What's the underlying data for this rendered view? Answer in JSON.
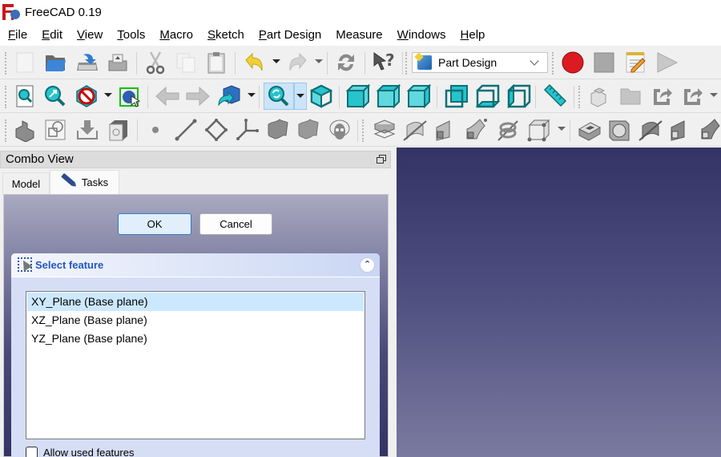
{
  "window": {
    "title": "FreeCAD 0.19",
    "logo_icon": "freecad-logo-icon"
  },
  "menubar": {
    "items": [
      {
        "label": "File",
        "mnemonic": "F",
        "rest": "ile"
      },
      {
        "label": "Edit",
        "mnemonic": "E",
        "rest": "dit"
      },
      {
        "label": "View",
        "mnemonic": "V",
        "rest": "iew"
      },
      {
        "label": "Tools",
        "mnemonic": "T",
        "rest": "ools"
      },
      {
        "label": "Macro",
        "mnemonic": "M",
        "rest": "acro"
      },
      {
        "label": "Sketch",
        "mnemonic": "S",
        "rest": "ketch"
      },
      {
        "label": "Part Design",
        "mnemonic": "P",
        "rest": "art Design"
      },
      {
        "label": "Measure",
        "mnemonic": "",
        "rest": "Measure"
      },
      {
        "label": "Windows",
        "mnemonic": "W",
        "rest": "indows"
      },
      {
        "label": "Help",
        "mnemonic": "H",
        "rest": "elp"
      }
    ]
  },
  "toolbars": {
    "file": [
      "new-document-icon",
      "open-folder-icon",
      "save-icon",
      "print-icon"
    ],
    "edit": [
      "cut-icon",
      "copy-icon",
      "paste-icon",
      "undo-icon",
      "redo-icon",
      "refresh-icon",
      "whats-this-icon"
    ],
    "workbench_selector": {
      "value": "Part Design",
      "icon": "part-design-icon"
    },
    "macro": [
      "macro-record-icon",
      "macro-stop-icon",
      "macro-edit-icon",
      "macro-execute-icon"
    ],
    "view": [
      "fit-all-icon",
      "fit-selection-icon",
      "draw-style-icon",
      "bounding-box-icon",
      "back-arrow-icon",
      "forward-arrow-icon",
      "send-to-python-icon",
      "sync-view-icon",
      "isometric-view-icon",
      "front-view-icon",
      "top-view-icon",
      "right-view-icon",
      "rear-view-icon",
      "bottom-view-icon",
      "left-view-icon",
      "measure-distance-icon"
    ],
    "structure": [
      "part-icon",
      "group-icon",
      "link-icon",
      "link-actions-icon"
    ],
    "partdesign_helpers": [
      "create-body-icon",
      "create-sketch-icon",
      "validate-sketch-icon",
      "clone-icon"
    ],
    "datums": [
      "datum-point-icon",
      "datum-line-icon",
      "datum-plane-icon",
      "local-coordinate-system-icon",
      "shape-binder-icon",
      "subshape-binder-icon",
      "sub-shape-binder-sheep-icon"
    ],
    "additive": [
      "pad-icon",
      "revolution-icon",
      "additive-loft-icon",
      "additive-pipe-icon",
      "additive-helix-icon",
      "additive-box-icon"
    ],
    "subtractive": [
      "pocket-icon",
      "hole-icon",
      "groove-icon",
      "subtractive-loft-icon",
      "subtractive-pipe-icon"
    ]
  },
  "combo_view": {
    "title": "Combo View",
    "tabs": [
      {
        "label": "Model",
        "active": false
      },
      {
        "label": "Tasks",
        "active": true,
        "icon": "pencil-icon"
      }
    ],
    "buttons": {
      "ok": "OK",
      "cancel": "Cancel"
    },
    "select_feature": {
      "title": "Select feature",
      "items": [
        {
          "label": "XY_Plane (Base plane)",
          "selected": true
        },
        {
          "label": "XZ_Plane (Base plane)",
          "selected": false
        },
        {
          "label": "YZ_Plane (Base plane)",
          "selected": false
        }
      ],
      "allow_used_features": {
        "label": "Allow used features",
        "checked": false
      }
    }
  },
  "colors": {
    "accent": "#2158c2",
    "selection": "#cce8ff",
    "view_top": "#333366",
    "view_bottom": "#7a7aa0",
    "record_red": "#d4161c",
    "teal_icon": "#26c4cc"
  }
}
